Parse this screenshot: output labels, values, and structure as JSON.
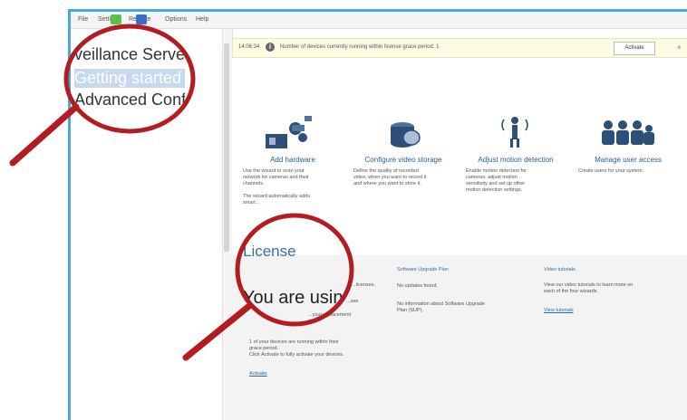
{
  "menubar": {
    "items": [
      "File",
      "Settings",
      "Remote",
      "Options",
      "Help"
    ]
  },
  "nav": {
    "items": [
      "veillance Server",
      "Getting started",
      "Advanced Conf"
    ]
  },
  "notification": {
    "time": "14:06:34",
    "message": "Number of devices currently running within license grace period: 1",
    "action": "Activate"
  },
  "wizard": {
    "cards": [
      {
        "title": "Add hardware",
        "desc": "Use the wizard to scan your\nnetwork for cameras and their\nchannels.\n\nThe wizard automatically adds\nsmart...",
        "icon": "hardware-icon"
      },
      {
        "title": "Configure video storage",
        "desc": "Define the quality of recorded\nvideo, when you want to record it\nand where you want to store it.",
        "icon": "storage-icon"
      },
      {
        "title": "Adjust motion detection",
        "desc": "Enable motion detection for\ncameras, adjust motion\nsensitivity and set up other\nmotion detection settings.",
        "icon": "motion-icon"
      },
      {
        "title": "Manage user access",
        "desc": "Create users for your system.",
        "icon": "users-icon"
      }
    ]
  },
  "license": {
    "heading": "License",
    "using": "You are usin",
    "line1": "...licenses.",
    "line2": "...see",
    "line3": "...your replacement\nsoft.",
    "grace": "1 of your devices are running within their\ngrace period.\nClick Activate to fully activate your devices.",
    "activate_link": "Activate"
  },
  "sup": {
    "heading": "Software Upgrade Plan",
    "none": "No updates found.",
    "info": "No information about Software Upgrade\nPlan (SUP)."
  },
  "tutorials": {
    "heading": "Video tutorials",
    "desc": "View our video tutorials to learn more on\neach of the four wizards.",
    "link": "View tutorials"
  },
  "colors": {
    "accent": "#4aa8d8",
    "callout": "#b31d22",
    "link": "#2a6bb0"
  }
}
